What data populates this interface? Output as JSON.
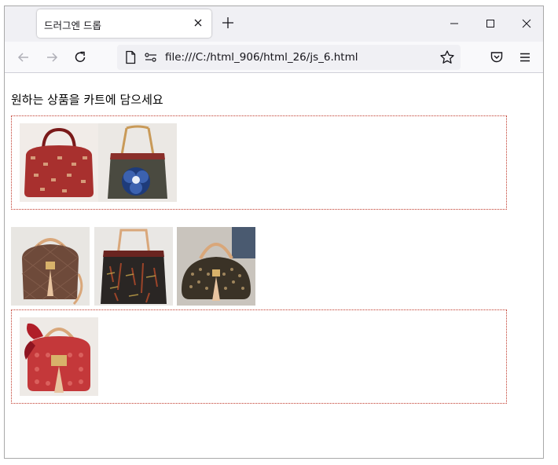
{
  "browser": {
    "tab_title": "드러그엔 드롭",
    "url": "file:///C:/html_906/html_26/js_6.html"
  },
  "page": {
    "heading": "원하는 상품을 카트에 담으세요",
    "cart_zone_items": [
      {
        "name": "red-patterned-bag"
      },
      {
        "name": "flower-tote-bag"
      }
    ],
    "product_items": [
      {
        "name": "brown-crossbody-bag"
      },
      {
        "name": "dark-tote-bag"
      },
      {
        "name": "woven-dome-bag"
      }
    ],
    "second_zone_items": [
      {
        "name": "red-scarf-bag"
      }
    ]
  },
  "icons": {
    "back": "back-arrow-icon",
    "forward": "forward-arrow-icon",
    "reload": "reload-icon",
    "page": "page-icon",
    "permissions": "permissions-icon",
    "bookmark": "star-icon",
    "pocket": "pocket-icon",
    "menu": "hamburger-menu-icon"
  },
  "colors": {
    "dropzone_border": "#c0392b",
    "tabbar_bg": "#f0f0f4"
  }
}
